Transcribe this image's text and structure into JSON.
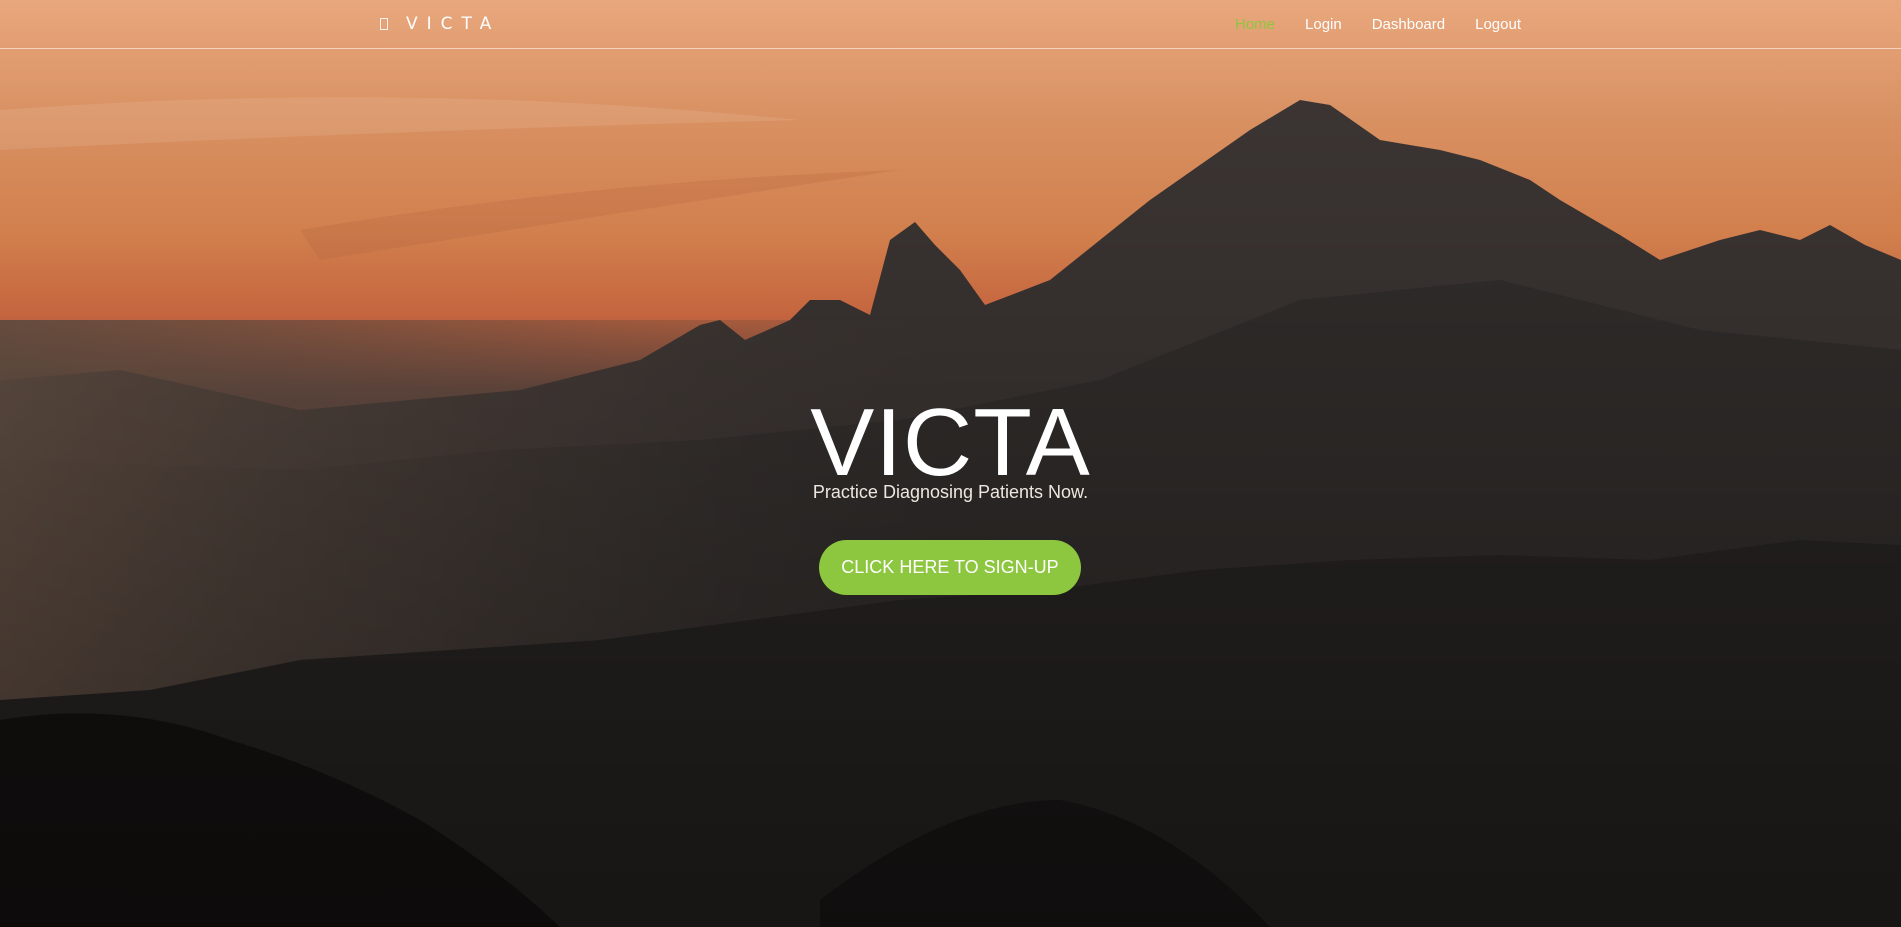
{
  "brand": {
    "icon": "tablet-icon",
    "name": "VICTA"
  },
  "nav": {
    "items": [
      {
        "label": "Home",
        "active": true
      },
      {
        "label": "Login",
        "active": false
      },
      {
        "label": "Dashboard",
        "active": false
      },
      {
        "label": "Logout",
        "active": false
      }
    ]
  },
  "hero": {
    "title": "VICTA",
    "subtitle": "Practice Diagnosing Patients Now.",
    "cta_label": "CLICK HERE TO SIGN-UP",
    "background": "sunset-mountain-landscape"
  },
  "colors": {
    "accent": "#8dc63f",
    "active_nav": "#8ec63f",
    "text": "#ffffff"
  }
}
